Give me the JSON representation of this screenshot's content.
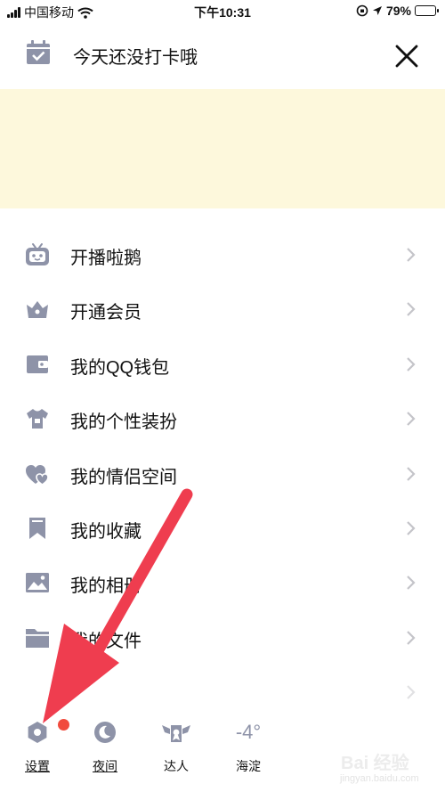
{
  "status_bar": {
    "carrier": "中国移动",
    "time": "下午10:31",
    "battery": "79%",
    "battery_level": 0.79,
    "icons": [
      "signal-icon",
      "wifi-icon",
      "lock-rotation-icon",
      "location-icon",
      "battery-icon"
    ]
  },
  "header": {
    "title": "今天还没打卡哦",
    "icons": [
      "calendar-check-icon",
      "close-icon"
    ]
  },
  "banner": {
    "color": "#fdf8dc"
  },
  "menu": {
    "items": [
      {
        "label": "开播啦鹅",
        "icon": "tv-robot-icon"
      },
      {
        "label": "开通会员",
        "icon": "crown-icon"
      },
      {
        "label": "我的QQ钱包",
        "icon": "wallet-icon"
      },
      {
        "label": "我的个性装扮",
        "icon": "tshirt-icon"
      },
      {
        "label": "我的情侣空间",
        "icon": "hearts-icon"
      },
      {
        "label": "我的收藏",
        "icon": "bookmark-icon"
      },
      {
        "label": "我的相册",
        "icon": "photo-icon"
      },
      {
        "label": "我的文件",
        "icon": "folder-icon"
      },
      {
        "label": "",
        "icon": ""
      }
    ]
  },
  "bottom_bar": {
    "settings_label": "设置",
    "night_label": "夜间",
    "expert_label": "达人",
    "weather_label": "海淀",
    "weather_temp": "-4°"
  },
  "colors": {
    "icon_gray": "#8e93a8",
    "arrow_red": "#ef3d4f",
    "badge_red": "#f14b3d",
    "chevron": "#c4c4c9"
  },
  "watermark": {
    "brand": "Bai 经验",
    "url": "jingyan.baidu.com"
  }
}
